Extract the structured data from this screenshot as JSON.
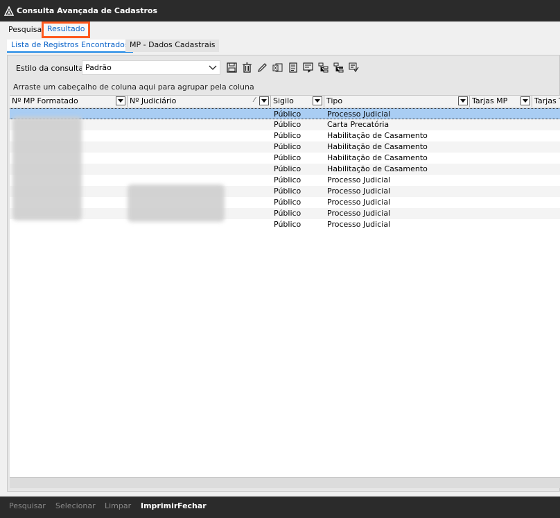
{
  "window": {
    "title": "Consulta Avançada de Cadastros"
  },
  "tabs": [
    {
      "label": "Pesquisa"
    },
    {
      "label": "Resultado"
    }
  ],
  "subtabs": [
    {
      "label": "Lista de Registros Encontrados"
    },
    {
      "label": "MP - Dados Cadastrais"
    }
  ],
  "toolbar": {
    "style_label": "Estilo da consulta",
    "style_value": "Padrão",
    "icons": [
      "save-icon",
      "delete-icon",
      "edit-icon",
      "export-excel-icon",
      "document-icon",
      "form-icon",
      "tree-icon",
      "tree-alt-icon",
      "checklist-icon"
    ]
  },
  "grid": {
    "group_hint": "Arraste um cabeçalho de coluna aqui para agrupar pela coluna",
    "columns": [
      "Nº MP Formatado",
      "Nº Judiciário",
      "Sigilo",
      "Tipo",
      "Tarjas MP",
      "Tarjas T"
    ],
    "rows": [
      {
        "sigilo": "Público",
        "tipo": "Processo Judicial"
      },
      {
        "sigilo": "Público",
        "tipo": "Carta Precatória"
      },
      {
        "sigilo": "Público",
        "tipo": "Habilitação de Casamento"
      },
      {
        "sigilo": "Público",
        "tipo": "Habilitação de Casamento"
      },
      {
        "sigilo": "Público",
        "tipo": "Habilitação de Casamento"
      },
      {
        "sigilo": "Público",
        "tipo": "Habilitação de Casamento"
      },
      {
        "sigilo": "Público",
        "tipo": "Processo Judicial"
      },
      {
        "sigilo": "Público",
        "tipo": "Processo Judicial"
      },
      {
        "sigilo": "Público",
        "tipo": "Processo Judicial"
      },
      {
        "sigilo": "Público",
        "tipo": "Processo Judicial"
      },
      {
        "sigilo": "Público",
        "tipo": "Processo Judicial"
      }
    ]
  },
  "footer": {
    "pesquisar": "Pesquisar",
    "selecionar": "Selecionar",
    "limpar": "Limpar",
    "imprimir": "Imprimir",
    "fechar": "Fechar"
  },
  "colors": {
    "accent": "#0a63c9",
    "highlight": "#ff5a1f",
    "selected_row": "#a9cdf3"
  }
}
